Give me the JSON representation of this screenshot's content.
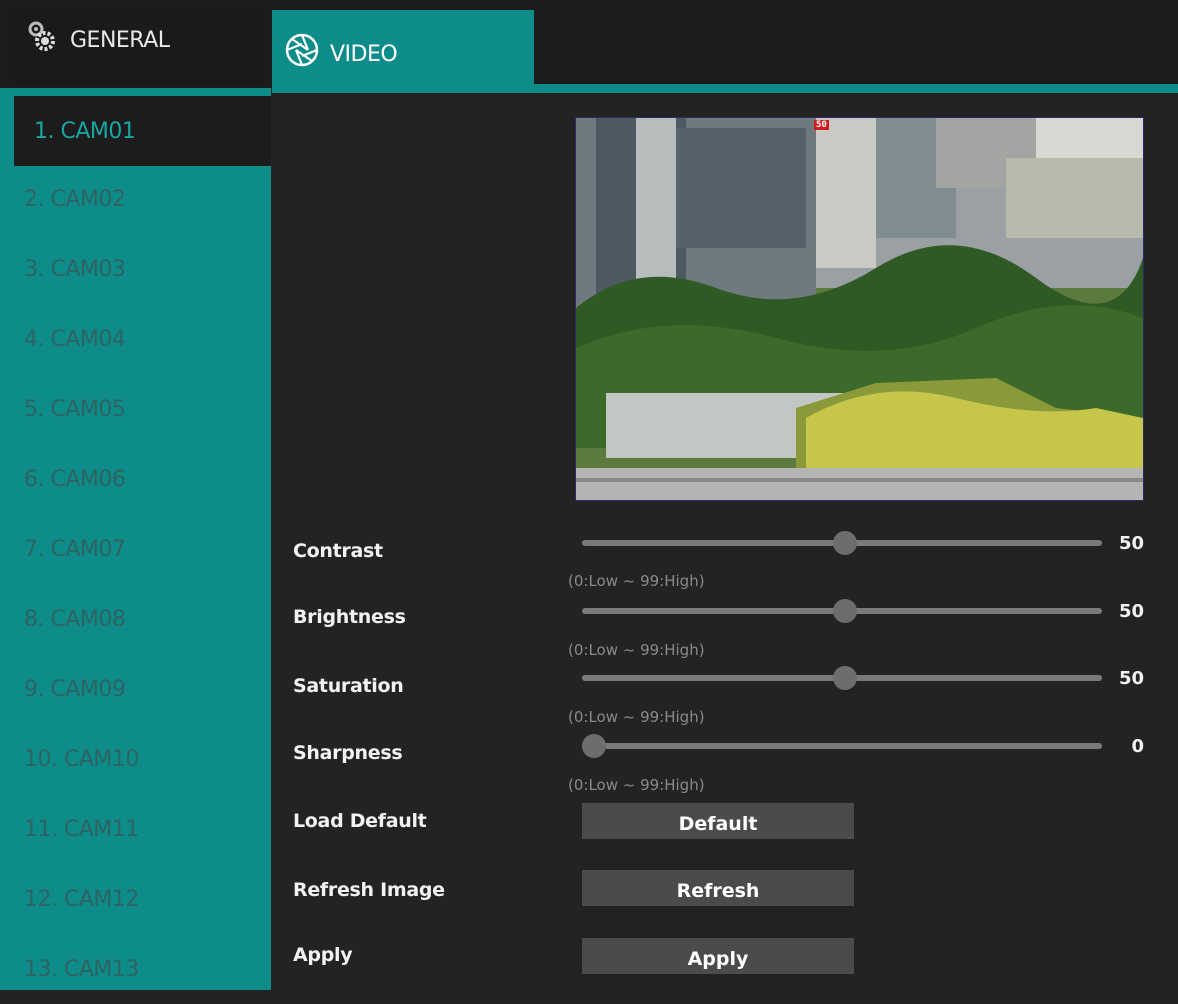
{
  "tabs": {
    "general": {
      "label": "GENERAL",
      "icon": "gears-icon"
    },
    "video": {
      "label": "VIDEO",
      "icon": "camera-shutter-icon"
    }
  },
  "accent_color": "#0d8c8a",
  "cameras": [
    {
      "label": "1. CAM01",
      "active": true
    },
    {
      "label": "2. CAM02"
    },
    {
      "label": "3. CAM03"
    },
    {
      "label": "4. CAM04"
    },
    {
      "label": "5. CAM05"
    },
    {
      "label": "6. CAM06"
    },
    {
      "label": "7. CAM07"
    },
    {
      "label": "8. CAM08"
    },
    {
      "label": "9. CAM09"
    },
    {
      "label": "10. CAM10"
    },
    {
      "label": "11. CAM11"
    },
    {
      "label": "12. CAM12"
    },
    {
      "label": "13. CAM13"
    }
  ],
  "preview": {
    "osd_label": "50"
  },
  "settings": {
    "contrast": {
      "label": "Contrast",
      "value": "50",
      "hint": "(0:Low ~ 99:High)",
      "min": 0,
      "max": 99
    },
    "brightness": {
      "label": "Brightness",
      "value": "50",
      "hint": "(0:Low ~ 99:High)",
      "min": 0,
      "max": 99
    },
    "saturation": {
      "label": "Saturation",
      "value": "50",
      "hint": "(0:Low ~ 99:High)",
      "min": 0,
      "max": 99
    },
    "sharpness": {
      "label": "Sharpness",
      "value": "0",
      "hint": "(0:Low ~ 99:High)",
      "min": 0,
      "max": 99
    }
  },
  "actions": {
    "load_default": {
      "label": "Load Default",
      "button": "Default"
    },
    "refresh_image": {
      "label": "Refresh Image",
      "button": "Refresh"
    },
    "apply": {
      "label": "Apply",
      "button": "Apply"
    }
  }
}
